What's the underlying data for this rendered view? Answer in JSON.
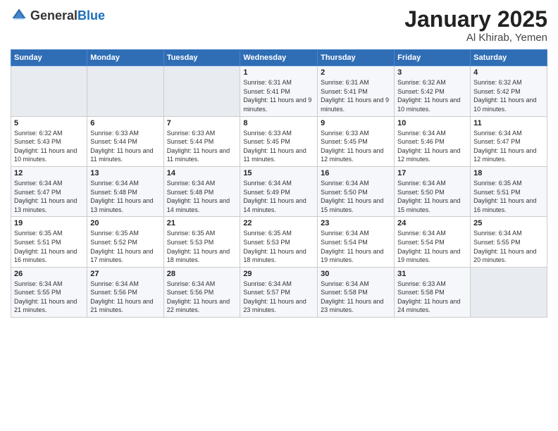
{
  "logo": {
    "general": "General",
    "blue": "Blue"
  },
  "title": {
    "month": "January 2025",
    "location": "Al Khirab, Yemen"
  },
  "weekdays": [
    "Sunday",
    "Monday",
    "Tuesday",
    "Wednesday",
    "Thursday",
    "Friday",
    "Saturday"
  ],
  "weeks": [
    [
      {
        "day": "",
        "sunrise": "",
        "sunset": "",
        "daylight": ""
      },
      {
        "day": "",
        "sunrise": "",
        "sunset": "",
        "daylight": ""
      },
      {
        "day": "",
        "sunrise": "",
        "sunset": "",
        "daylight": ""
      },
      {
        "day": "1",
        "sunrise": "Sunrise: 6:31 AM",
        "sunset": "Sunset: 5:41 PM",
        "daylight": "Daylight: 11 hours and 9 minutes."
      },
      {
        "day": "2",
        "sunrise": "Sunrise: 6:31 AM",
        "sunset": "Sunset: 5:41 PM",
        "daylight": "Daylight: 11 hours and 9 minutes."
      },
      {
        "day": "3",
        "sunrise": "Sunrise: 6:32 AM",
        "sunset": "Sunset: 5:42 PM",
        "daylight": "Daylight: 11 hours and 10 minutes."
      },
      {
        "day": "4",
        "sunrise": "Sunrise: 6:32 AM",
        "sunset": "Sunset: 5:42 PM",
        "daylight": "Daylight: 11 hours and 10 minutes."
      }
    ],
    [
      {
        "day": "5",
        "sunrise": "Sunrise: 6:32 AM",
        "sunset": "Sunset: 5:43 PM",
        "daylight": "Daylight: 11 hours and 10 minutes."
      },
      {
        "day": "6",
        "sunrise": "Sunrise: 6:33 AM",
        "sunset": "Sunset: 5:44 PM",
        "daylight": "Daylight: 11 hours and 11 minutes."
      },
      {
        "day": "7",
        "sunrise": "Sunrise: 6:33 AM",
        "sunset": "Sunset: 5:44 PM",
        "daylight": "Daylight: 11 hours and 11 minutes."
      },
      {
        "day": "8",
        "sunrise": "Sunrise: 6:33 AM",
        "sunset": "Sunset: 5:45 PM",
        "daylight": "Daylight: 11 hours and 11 minutes."
      },
      {
        "day": "9",
        "sunrise": "Sunrise: 6:33 AM",
        "sunset": "Sunset: 5:45 PM",
        "daylight": "Daylight: 11 hours and 12 minutes."
      },
      {
        "day": "10",
        "sunrise": "Sunrise: 6:34 AM",
        "sunset": "Sunset: 5:46 PM",
        "daylight": "Daylight: 11 hours and 12 minutes."
      },
      {
        "day": "11",
        "sunrise": "Sunrise: 6:34 AM",
        "sunset": "Sunset: 5:47 PM",
        "daylight": "Daylight: 11 hours and 12 minutes."
      }
    ],
    [
      {
        "day": "12",
        "sunrise": "Sunrise: 6:34 AM",
        "sunset": "Sunset: 5:47 PM",
        "daylight": "Daylight: 11 hours and 13 minutes."
      },
      {
        "day": "13",
        "sunrise": "Sunrise: 6:34 AM",
        "sunset": "Sunset: 5:48 PM",
        "daylight": "Daylight: 11 hours and 13 minutes."
      },
      {
        "day": "14",
        "sunrise": "Sunrise: 6:34 AM",
        "sunset": "Sunset: 5:48 PM",
        "daylight": "Daylight: 11 hours and 14 minutes."
      },
      {
        "day": "15",
        "sunrise": "Sunrise: 6:34 AM",
        "sunset": "Sunset: 5:49 PM",
        "daylight": "Daylight: 11 hours and 14 minutes."
      },
      {
        "day": "16",
        "sunrise": "Sunrise: 6:34 AM",
        "sunset": "Sunset: 5:50 PM",
        "daylight": "Daylight: 11 hours and 15 minutes."
      },
      {
        "day": "17",
        "sunrise": "Sunrise: 6:34 AM",
        "sunset": "Sunset: 5:50 PM",
        "daylight": "Daylight: 11 hours and 15 minutes."
      },
      {
        "day": "18",
        "sunrise": "Sunrise: 6:35 AM",
        "sunset": "Sunset: 5:51 PM",
        "daylight": "Daylight: 11 hours and 16 minutes."
      }
    ],
    [
      {
        "day": "19",
        "sunrise": "Sunrise: 6:35 AM",
        "sunset": "Sunset: 5:51 PM",
        "daylight": "Daylight: 11 hours and 16 minutes."
      },
      {
        "day": "20",
        "sunrise": "Sunrise: 6:35 AM",
        "sunset": "Sunset: 5:52 PM",
        "daylight": "Daylight: 11 hours and 17 minutes."
      },
      {
        "day": "21",
        "sunrise": "Sunrise: 6:35 AM",
        "sunset": "Sunset: 5:53 PM",
        "daylight": "Daylight: 11 hours and 18 minutes."
      },
      {
        "day": "22",
        "sunrise": "Sunrise: 6:35 AM",
        "sunset": "Sunset: 5:53 PM",
        "daylight": "Daylight: 11 hours and 18 minutes."
      },
      {
        "day": "23",
        "sunrise": "Sunrise: 6:34 AM",
        "sunset": "Sunset: 5:54 PM",
        "daylight": "Daylight: 11 hours and 19 minutes."
      },
      {
        "day": "24",
        "sunrise": "Sunrise: 6:34 AM",
        "sunset": "Sunset: 5:54 PM",
        "daylight": "Daylight: 11 hours and 19 minutes."
      },
      {
        "day": "25",
        "sunrise": "Sunrise: 6:34 AM",
        "sunset": "Sunset: 5:55 PM",
        "daylight": "Daylight: 11 hours and 20 minutes."
      }
    ],
    [
      {
        "day": "26",
        "sunrise": "Sunrise: 6:34 AM",
        "sunset": "Sunset: 5:55 PM",
        "daylight": "Daylight: 11 hours and 21 minutes."
      },
      {
        "day": "27",
        "sunrise": "Sunrise: 6:34 AM",
        "sunset": "Sunset: 5:56 PM",
        "daylight": "Daylight: 11 hours and 21 minutes."
      },
      {
        "day": "28",
        "sunrise": "Sunrise: 6:34 AM",
        "sunset": "Sunset: 5:56 PM",
        "daylight": "Daylight: 11 hours and 22 minutes."
      },
      {
        "day": "29",
        "sunrise": "Sunrise: 6:34 AM",
        "sunset": "Sunset: 5:57 PM",
        "daylight": "Daylight: 11 hours and 23 minutes."
      },
      {
        "day": "30",
        "sunrise": "Sunrise: 6:34 AM",
        "sunset": "Sunset: 5:58 PM",
        "daylight": "Daylight: 11 hours and 23 minutes."
      },
      {
        "day": "31",
        "sunrise": "Sunrise: 6:33 AM",
        "sunset": "Sunset: 5:58 PM",
        "daylight": "Daylight: 11 hours and 24 minutes."
      },
      {
        "day": "",
        "sunrise": "",
        "sunset": "",
        "daylight": ""
      }
    ]
  ]
}
